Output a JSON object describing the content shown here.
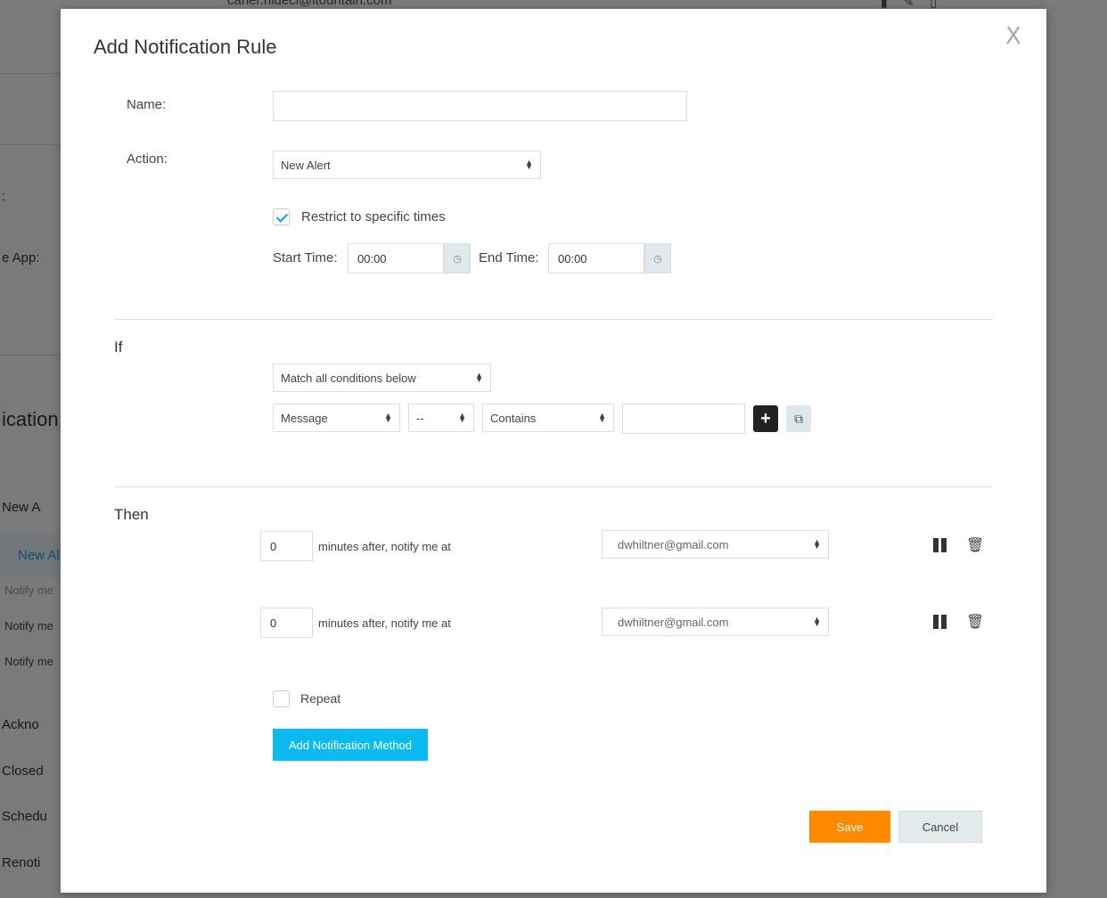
{
  "background": {
    "top_email": "caner.hideci@itountain.com",
    "label_colon": ":",
    "label_app": "e App:",
    "heading": "ication",
    "items": [
      "New A",
      "New Al",
      "Notify me",
      "Notify me",
      "Notify me",
      "Ackno",
      "Closed",
      "Schedu",
      "Renoti"
    ]
  },
  "modal": {
    "title": "Add Notification Rule",
    "close_label": "X",
    "name_label": "Name:",
    "name_value": "",
    "action_label": "Action:",
    "action_value": "New Alert",
    "restrict_label": "Restrict to specific times",
    "restrict_checked": true,
    "start_time_label": "Start Time:",
    "start_time_value": "00:00",
    "end_time_label": "End Time:",
    "end_time_value": "00:00",
    "if_section": {
      "title": "If",
      "match_value": "Match all conditions below",
      "condition": {
        "field": "Message",
        "sub": "--",
        "operator": "Contains",
        "value": ""
      }
    },
    "then_section": {
      "title": "Then",
      "rows": [
        {
          "minutes": "0",
          "label": "minutes after, notify me at",
          "target": "dwhiltner@gmail.com"
        },
        {
          "minutes": "0",
          "label": "minutes after, notify me at",
          "target": "dwhiltner@gmail.com"
        }
      ],
      "repeat_label": "Repeat",
      "repeat_checked": false,
      "add_method_label": "Add Notification Method"
    },
    "save_label": "Save",
    "cancel_label": "Cancel"
  }
}
